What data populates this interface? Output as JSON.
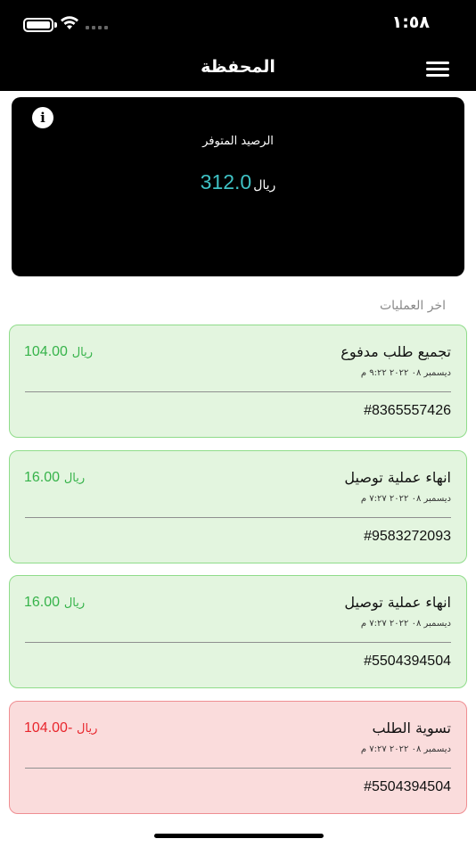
{
  "status_bar": {
    "time": "١:٥٨"
  },
  "header": {
    "title": "المحفظة"
  },
  "balance": {
    "label": "الرصيد المتوفر",
    "amount": "312.0",
    "currency": "ريال"
  },
  "transactions_section": {
    "title": "اخر العمليات"
  },
  "transactions": [
    {
      "title": "تجميع طلب مدفوع",
      "date": "ديسمبر ٠٨ ٢٠٢٢ ٩:٢٢ م",
      "amount": "104.00",
      "currency": "ريال",
      "id": "#8365557426",
      "kind": "credit"
    },
    {
      "title": "انهاء عملية توصيل",
      "date": "ديسمبر ٠٨ ٢٠٢٢ ٧:٢٧ م",
      "amount": "16.00",
      "currency": "ريال",
      "id": "#9583272093",
      "kind": "credit"
    },
    {
      "title": "انهاء عملية توصيل",
      "date": "ديسمبر ٠٨ ٢٠٢٢ ٧:٢٧ م",
      "amount": "16.00",
      "currency": "ريال",
      "id": "#5504394504",
      "kind": "credit"
    },
    {
      "title": "تسوية الطلب",
      "date": "ديسمبر ٠٨ ٢٠٢٢ ٧:٢٧ م",
      "amount": "104.00-",
      "currency": "ريال",
      "id": "#5504394504",
      "kind": "debit"
    }
  ],
  "colors": {
    "header_bg": "#000000",
    "balance_amount": "#3fc1c4",
    "credit_bg": "#e3f5df",
    "credit_border": "#8fdc8a",
    "credit_text": "#36b34a",
    "debit_bg": "#fadcdc",
    "debit_border": "#ef8e92",
    "debit_text": "#e8262d"
  },
  "icons": {
    "menu": "hamburger-menu-icon",
    "info": "info-icon",
    "battery": "battery-icon",
    "wifi": "wifi-icon",
    "signal": "cellular-signal-icon"
  }
}
